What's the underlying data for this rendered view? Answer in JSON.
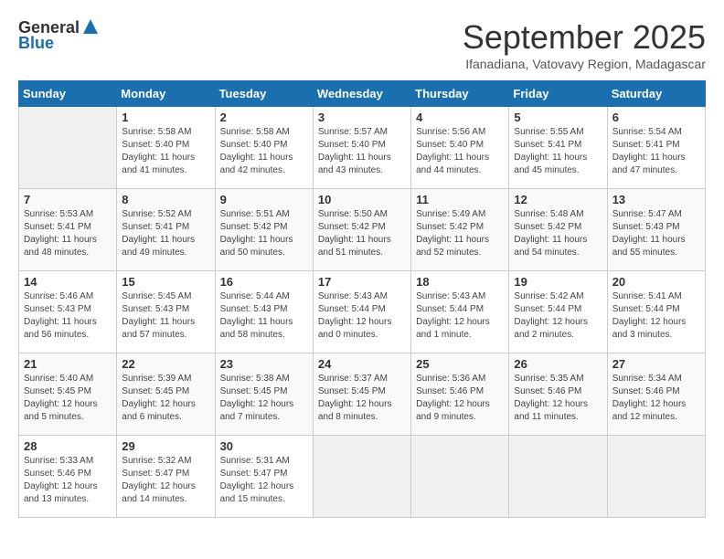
{
  "header": {
    "logo_general": "General",
    "logo_blue": "Blue",
    "month": "September 2025",
    "location": "Ifanadiana, Vatovavy Region, Madagascar"
  },
  "days_of_week": [
    "Sunday",
    "Monday",
    "Tuesday",
    "Wednesday",
    "Thursday",
    "Friday",
    "Saturday"
  ],
  "weeks": [
    [
      {
        "day": "",
        "info": ""
      },
      {
        "day": "1",
        "info": "Sunrise: 5:58 AM\nSunset: 5:40 PM\nDaylight: 11 hours\nand 41 minutes."
      },
      {
        "day": "2",
        "info": "Sunrise: 5:58 AM\nSunset: 5:40 PM\nDaylight: 11 hours\nand 42 minutes."
      },
      {
        "day": "3",
        "info": "Sunrise: 5:57 AM\nSunset: 5:40 PM\nDaylight: 11 hours\nand 43 minutes."
      },
      {
        "day": "4",
        "info": "Sunrise: 5:56 AM\nSunset: 5:40 PM\nDaylight: 11 hours\nand 44 minutes."
      },
      {
        "day": "5",
        "info": "Sunrise: 5:55 AM\nSunset: 5:41 PM\nDaylight: 11 hours\nand 45 minutes."
      },
      {
        "day": "6",
        "info": "Sunrise: 5:54 AM\nSunset: 5:41 PM\nDaylight: 11 hours\nand 47 minutes."
      }
    ],
    [
      {
        "day": "7",
        "info": "Sunrise: 5:53 AM\nSunset: 5:41 PM\nDaylight: 11 hours\nand 48 minutes."
      },
      {
        "day": "8",
        "info": "Sunrise: 5:52 AM\nSunset: 5:41 PM\nDaylight: 11 hours\nand 49 minutes."
      },
      {
        "day": "9",
        "info": "Sunrise: 5:51 AM\nSunset: 5:42 PM\nDaylight: 11 hours\nand 50 minutes."
      },
      {
        "day": "10",
        "info": "Sunrise: 5:50 AM\nSunset: 5:42 PM\nDaylight: 11 hours\nand 51 minutes."
      },
      {
        "day": "11",
        "info": "Sunrise: 5:49 AM\nSunset: 5:42 PM\nDaylight: 11 hours\nand 52 minutes."
      },
      {
        "day": "12",
        "info": "Sunrise: 5:48 AM\nSunset: 5:42 PM\nDaylight: 11 hours\nand 54 minutes."
      },
      {
        "day": "13",
        "info": "Sunrise: 5:47 AM\nSunset: 5:43 PM\nDaylight: 11 hours\nand 55 minutes."
      }
    ],
    [
      {
        "day": "14",
        "info": "Sunrise: 5:46 AM\nSunset: 5:43 PM\nDaylight: 11 hours\nand 56 minutes."
      },
      {
        "day": "15",
        "info": "Sunrise: 5:45 AM\nSunset: 5:43 PM\nDaylight: 11 hours\nand 57 minutes."
      },
      {
        "day": "16",
        "info": "Sunrise: 5:44 AM\nSunset: 5:43 PM\nDaylight: 11 hours\nand 58 minutes."
      },
      {
        "day": "17",
        "info": "Sunrise: 5:43 AM\nSunset: 5:44 PM\nDaylight: 12 hours\nand 0 minutes."
      },
      {
        "day": "18",
        "info": "Sunrise: 5:43 AM\nSunset: 5:44 PM\nDaylight: 12 hours\nand 1 minute."
      },
      {
        "day": "19",
        "info": "Sunrise: 5:42 AM\nSunset: 5:44 PM\nDaylight: 12 hours\nand 2 minutes."
      },
      {
        "day": "20",
        "info": "Sunrise: 5:41 AM\nSunset: 5:44 PM\nDaylight: 12 hours\nand 3 minutes."
      }
    ],
    [
      {
        "day": "21",
        "info": "Sunrise: 5:40 AM\nSunset: 5:45 PM\nDaylight: 12 hours\nand 5 minutes."
      },
      {
        "day": "22",
        "info": "Sunrise: 5:39 AM\nSunset: 5:45 PM\nDaylight: 12 hours\nand 6 minutes."
      },
      {
        "day": "23",
        "info": "Sunrise: 5:38 AM\nSunset: 5:45 PM\nDaylight: 12 hours\nand 7 minutes."
      },
      {
        "day": "24",
        "info": "Sunrise: 5:37 AM\nSunset: 5:45 PM\nDaylight: 12 hours\nand 8 minutes."
      },
      {
        "day": "25",
        "info": "Sunrise: 5:36 AM\nSunset: 5:46 PM\nDaylight: 12 hours\nand 9 minutes."
      },
      {
        "day": "26",
        "info": "Sunrise: 5:35 AM\nSunset: 5:46 PM\nDaylight: 12 hours\nand 11 minutes."
      },
      {
        "day": "27",
        "info": "Sunrise: 5:34 AM\nSunset: 5:46 PM\nDaylight: 12 hours\nand 12 minutes."
      }
    ],
    [
      {
        "day": "28",
        "info": "Sunrise: 5:33 AM\nSunset: 5:46 PM\nDaylight: 12 hours\nand 13 minutes."
      },
      {
        "day": "29",
        "info": "Sunrise: 5:32 AM\nSunset: 5:47 PM\nDaylight: 12 hours\nand 14 minutes."
      },
      {
        "day": "30",
        "info": "Sunrise: 5:31 AM\nSunset: 5:47 PM\nDaylight: 12 hours\nand 15 minutes."
      },
      {
        "day": "",
        "info": ""
      },
      {
        "day": "",
        "info": ""
      },
      {
        "day": "",
        "info": ""
      },
      {
        "day": "",
        "info": ""
      }
    ]
  ]
}
